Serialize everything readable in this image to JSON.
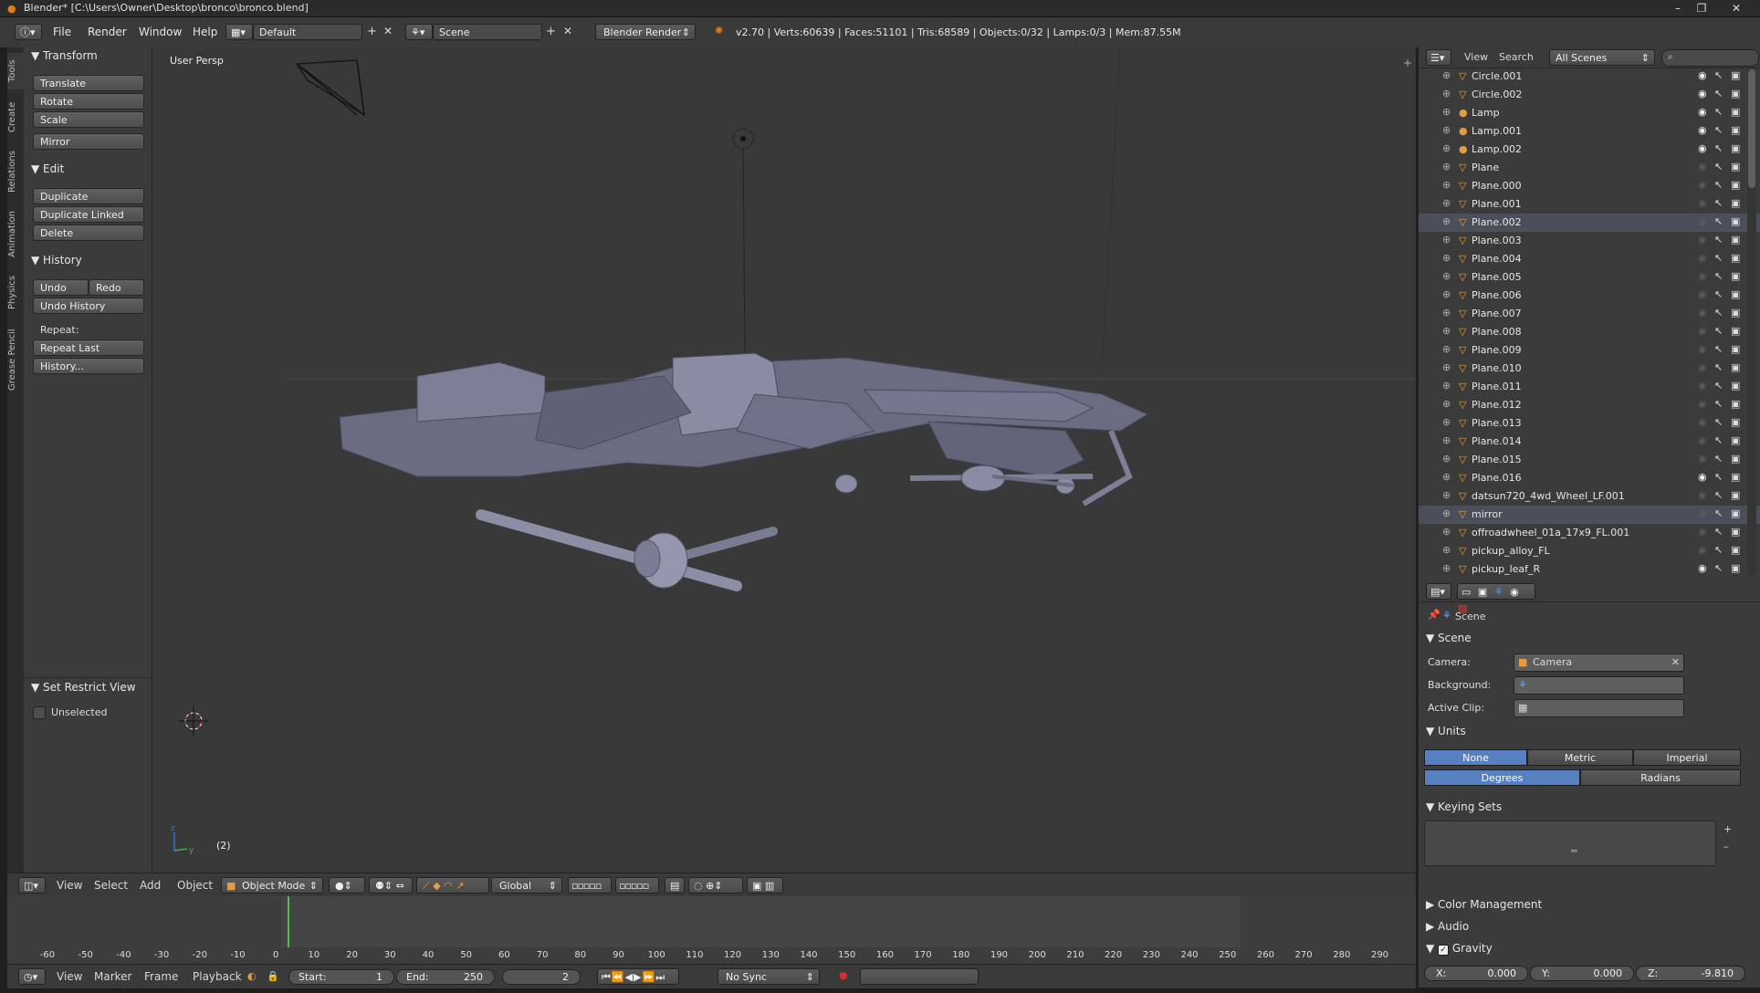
{
  "window": {
    "title": "Blender* [C:\\Users\\Owner\\Desktop\\bronco\\bronco.blend]",
    "controls": [
      "–",
      "❐",
      "✕"
    ]
  },
  "info_header": {
    "menus": [
      "File",
      "Render",
      "Window",
      "Help"
    ],
    "layout": "Default",
    "scene": "Scene",
    "engine": "Blender Render",
    "stats": "v2.70 | Verts:60639 | Faces:51101 | Tris:68589 | Objects:0/32 | Lamps:0/3 | Mem:87.55M"
  },
  "tool_tabs": [
    "Tools",
    "Create",
    "Relations",
    "Animation",
    "Physics",
    "Grease Pencil"
  ],
  "toolshelf": {
    "transform": {
      "title": "Transform",
      "buttons": [
        "Translate",
        "Rotate",
        "Scale",
        "Mirror"
      ]
    },
    "edit": {
      "title": "Edit",
      "buttons": [
        "Duplicate",
        "Duplicate Linked",
        "Delete"
      ]
    },
    "history": {
      "title": "History",
      "undo": "Undo",
      "redo": "Redo",
      "undo_history": "Undo History",
      "repeat_label": "Repeat:",
      "repeat_last": "Repeat Last",
      "history_btn": "History..."
    },
    "restrict": {
      "title": "Set Restrict View",
      "unselected": "Unselected"
    }
  },
  "viewport": {
    "label": "User Persp",
    "frame_indicator": "(2)"
  },
  "view3d_header": {
    "menus": [
      "View",
      "Select",
      "Add",
      "Object"
    ],
    "mode": "Object Mode",
    "orientation": "Global"
  },
  "timeline": {
    "ticks": [
      "-60",
      "-50",
      "-40",
      "-30",
      "-20",
      "-10",
      "0",
      "10",
      "20",
      "30",
      "40",
      "50",
      "60",
      "70",
      "80",
      "90",
      "100",
      "110",
      "120",
      "130",
      "140",
      "150",
      "160",
      "170",
      "180",
      "190",
      "200",
      "210",
      "220",
      "230",
      "240",
      "250",
      "260",
      "270",
      "280",
      "290"
    ],
    "current_frame_value": 2,
    "menus": [
      "View",
      "Marker",
      "Frame",
      "Playback"
    ],
    "start_label": "Start:",
    "start": "1",
    "end_label": "End:",
    "end": "250",
    "frame": "2",
    "sync": "No Sync"
  },
  "outliner": {
    "menus": [
      "View",
      "Search"
    ],
    "filter": "All Scenes",
    "rows": [
      {
        "name": "Circle.001",
        "kind": "mesh",
        "visible": true
      },
      {
        "name": "Circle.002",
        "kind": "mesh",
        "visible": true
      },
      {
        "name": "Lamp",
        "kind": "lamp",
        "visible": true
      },
      {
        "name": "Lamp.001",
        "kind": "lamp",
        "visible": true
      },
      {
        "name": "Lamp.002",
        "kind": "lamp",
        "visible": true
      },
      {
        "name": "Plane",
        "kind": "mesh",
        "visible": false
      },
      {
        "name": "Plane.000",
        "kind": "mesh",
        "visible": false
      },
      {
        "name": "Plane.001",
        "kind": "mesh",
        "visible": false
      },
      {
        "name": "Plane.002",
        "kind": "mesh",
        "visible": false
      },
      {
        "name": "Plane.003",
        "kind": "mesh",
        "visible": false
      },
      {
        "name": "Plane.004",
        "kind": "mesh",
        "visible": false
      },
      {
        "name": "Plane.005",
        "kind": "mesh",
        "visible": false
      },
      {
        "name": "Plane.006",
        "kind": "mesh",
        "visible": false
      },
      {
        "name": "Plane.007",
        "kind": "mesh",
        "visible": false
      },
      {
        "name": "Plane.008",
        "kind": "mesh",
        "visible": false
      },
      {
        "name": "Plane.009",
        "kind": "mesh",
        "visible": false
      },
      {
        "name": "Plane.010",
        "kind": "mesh",
        "visible": false
      },
      {
        "name": "Plane.011",
        "kind": "mesh",
        "visible": false
      },
      {
        "name": "Plane.012",
        "kind": "mesh",
        "visible": false
      },
      {
        "name": "Plane.013",
        "kind": "mesh",
        "visible": false
      },
      {
        "name": "Plane.014",
        "kind": "mesh",
        "visible": false
      },
      {
        "name": "Plane.015",
        "kind": "mesh",
        "visible": false
      },
      {
        "name": "Plane.016",
        "kind": "mesh",
        "visible": true
      },
      {
        "name": "datsun720_4wd_Wheel_LF.001",
        "kind": "mesh",
        "visible": false
      },
      {
        "name": "mirror",
        "kind": "mesh",
        "visible": false
      },
      {
        "name": "offroadwheel_01a_17x9_FL.001",
        "kind": "mesh",
        "visible": false
      },
      {
        "name": "pickup_alloy_FL",
        "kind": "mesh",
        "visible": false
      },
      {
        "name": "pickup_leaf_R",
        "kind": "mesh",
        "visible": true
      }
    ]
  },
  "properties": {
    "context": "Scene",
    "scene_section": "Scene",
    "camera_label": "Camera:",
    "camera_value": "Camera",
    "background_label": "Background:",
    "active_clip_label": "Active Clip:",
    "units_section": "Units",
    "unit_systems": [
      "None",
      "Metric",
      "Imperial"
    ],
    "rotation_units": [
      "Degrees",
      "Radians"
    ],
    "keying_section": "Keying Sets",
    "color_management": "Color Management",
    "audio": "Audio",
    "gravity": "Gravity",
    "gravity_x": "X:",
    "gravity_x_val": "0.000",
    "gravity_y": "Y:",
    "gravity_y_val": "0.000",
    "gravity_z": "Z:",
    "gravity_z_val": "-9.810"
  }
}
